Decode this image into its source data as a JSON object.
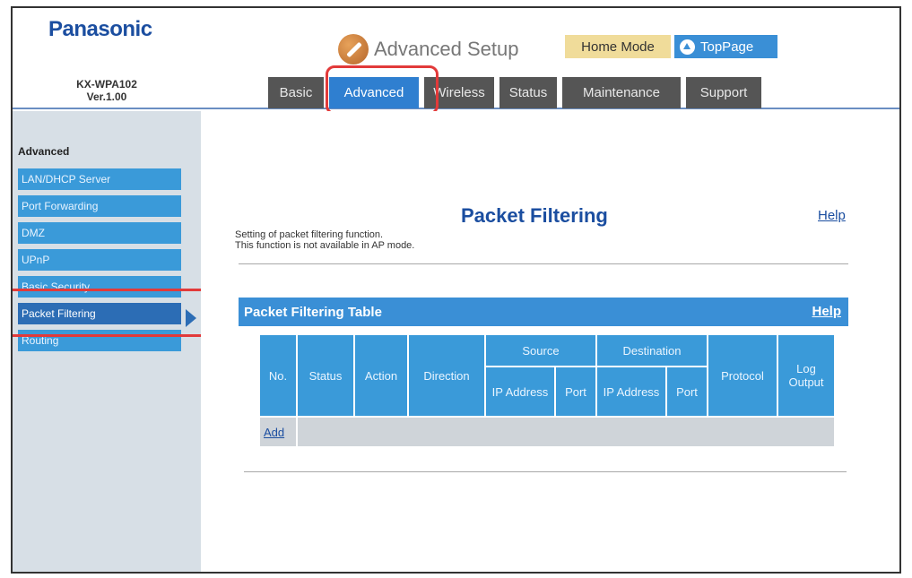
{
  "header": {
    "brand": "Panasonic",
    "model": "KX-WPA102",
    "version": "Ver.1.00",
    "app_title": "Advanced Setup",
    "home_mode": "Home Mode",
    "toppage": "TopPage"
  },
  "tabs": [
    {
      "label": "Basic"
    },
    {
      "label": "Advanced",
      "active": true
    },
    {
      "label": "Wireless"
    },
    {
      "label": "Status"
    },
    {
      "label": "Maintenance"
    },
    {
      "label": "Support"
    }
  ],
  "sidebar": {
    "title": "Advanced",
    "items": [
      {
        "label": "LAN/DHCP Server"
      },
      {
        "label": "Port Forwarding"
      },
      {
        "label": "DMZ"
      },
      {
        "label": "UPnP"
      },
      {
        "label": "Basic Security"
      },
      {
        "label": "Packet Filtering",
        "active": true
      },
      {
        "label": "Routing"
      }
    ]
  },
  "main": {
    "title": "Packet Filtering",
    "help": "Help",
    "desc_line1": "Setting of packet filtering function.",
    "desc_line2": "This function is not available in AP mode.",
    "table_title": "Packet Filtering Table",
    "table_help": "Help",
    "columns": {
      "no": "No.",
      "status": "Status",
      "action": "Action",
      "direction": "Direction",
      "source": "Source",
      "destination": "Destination",
      "ip_address": "IP Address",
      "port": "Port",
      "protocol": "Protocol",
      "log_output": "Log Output"
    },
    "add": "Add"
  },
  "colors": {
    "accent_blue": "#3a8fd6",
    "brand_blue": "#1b4ea0",
    "tab_dark": "#555555",
    "home_mode_bg": "#f0dc9a",
    "highlight_red": "#e23a3a"
  }
}
